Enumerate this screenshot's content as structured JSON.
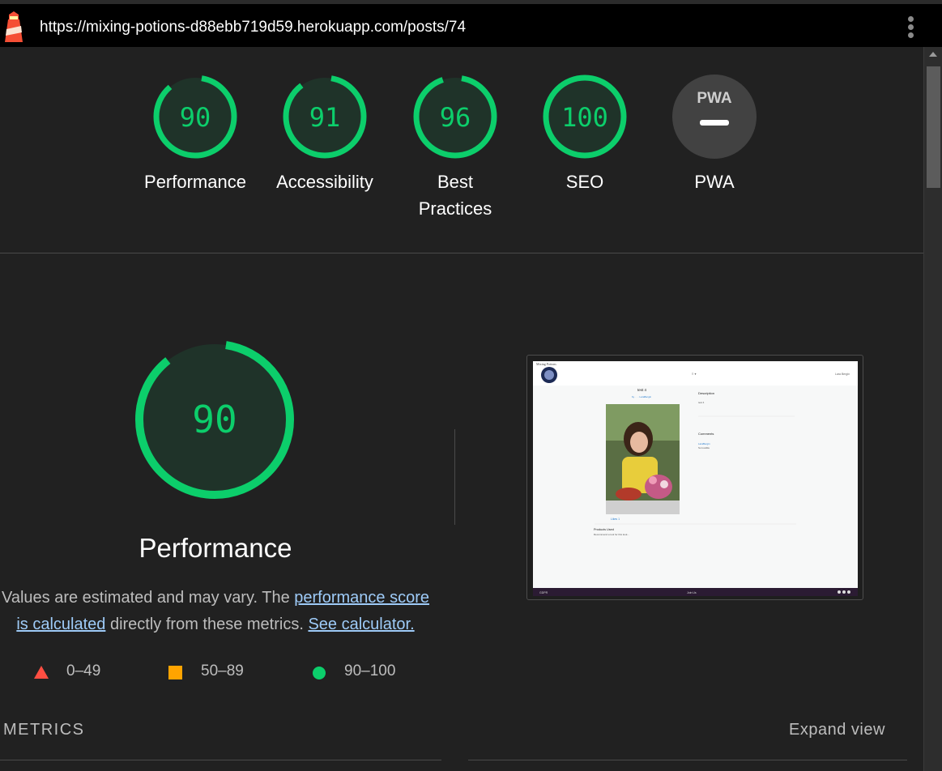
{
  "browser": {
    "url": "https://mixing-potions-d88ebb719d59.herokuapp.com/posts/74"
  },
  "gauges": [
    {
      "score": "90",
      "label": "Performance",
      "fraction": 0.9,
      "color": "#0cce6b"
    },
    {
      "score": "91",
      "label": "Accessibility",
      "fraction": 0.91,
      "color": "#0cce6b"
    },
    {
      "score": "96",
      "label": "Best Practices",
      "fraction": 0.96,
      "color": "#0cce6b"
    },
    {
      "score": "100",
      "label": "SEO",
      "fraction": 1.0,
      "color": "#0cce6b"
    },
    {
      "score": "PWA",
      "label": "PWA",
      "fraction": 0,
      "color": "#424242"
    }
  ],
  "performance": {
    "score": "90",
    "fraction": 0.9,
    "title": "Performance",
    "desc_prefix": "Values are estimated and may vary. The ",
    "link1": "performance score is calculated",
    "desc_middle": " directly from these metrics. ",
    "link2": "See calculator."
  },
  "legend": [
    {
      "range": "0–49",
      "shape": "triangle",
      "color": "#ff4e42"
    },
    {
      "range": "50–89",
      "shape": "square",
      "color": "#ffa400"
    },
    {
      "range": "90–100",
      "shape": "circle",
      "color": "#0cce6b"
    }
  ],
  "metrics": {
    "title": "METRICS",
    "expand_label": "Expand view"
  },
  "screenshot": {
    "logo_text": "Mixing Potions",
    "user_text": "Lara Bergin",
    "post_title": "test 4",
    "post_meta": "by · · · LaraBergin",
    "description_heading": "Description",
    "description_text": "test 4",
    "comments_heading": "Comments",
    "comment_user": "LaraBergin",
    "comment_text": "So lovable",
    "likes": "Likes 1",
    "products_heading": "Products Used",
    "products_text": "Recommend a tool for this look...",
    "footer_left": "GDPR",
    "footer_mid": "Join Us"
  },
  "colors": {
    "pass": "#0cce6b",
    "average": "#ffa400",
    "fail": "#ff4e42",
    "link": "#9ecbf8"
  }
}
